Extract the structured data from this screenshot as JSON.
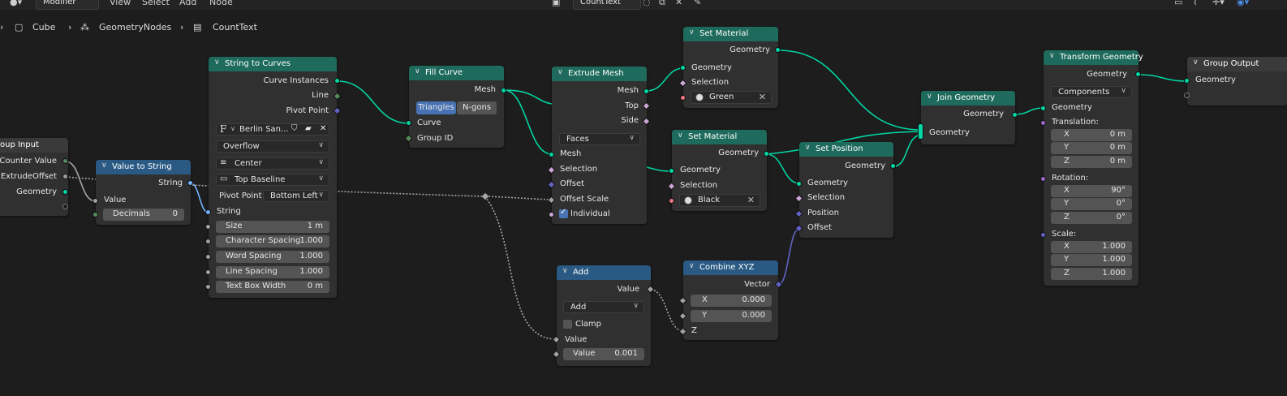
{
  "topbar": {
    "editor_type": "Modifier",
    "menus": [
      "View",
      "Select",
      "Add",
      "Node"
    ],
    "node_tree_name": "CountText"
  },
  "breadcrumb": [
    "Cube",
    "GeometryNodes",
    "CountText"
  ],
  "nodes": {
    "group_input": {
      "title": "oup Input",
      "outputs": [
        "Counter Value",
        "ExtrudeOffset",
        "Geometry"
      ]
    },
    "value_to_string": {
      "title": "Value to String",
      "output": "String",
      "input_value": "Value",
      "decimals_label": "Decimals",
      "decimals_value": "0"
    },
    "string_to_curves": {
      "title": "String to Curves",
      "outputs": [
        "Curve Instances",
        "Line",
        "Pivot Point"
      ],
      "font": "Berlin San...",
      "overflow": "Overflow",
      "align_x": "Center",
      "align_y": "Top Baseline",
      "pivot_label": "Pivot Point",
      "pivot_value": "Bottom Left",
      "input_string": "String",
      "fields": [
        {
          "label": "Size",
          "value": "1 m"
        },
        {
          "label": "Character Spacing",
          "value": "1.000"
        },
        {
          "label": "Word Spacing",
          "value": "1.000"
        },
        {
          "label": "Line Spacing",
          "value": "1.000"
        },
        {
          "label": "Text Box Width",
          "value": "0 m"
        }
      ]
    },
    "fill_curve": {
      "title": "Fill Curve",
      "output": "Mesh",
      "modes": [
        "Triangles",
        "N-gons"
      ],
      "inputs": [
        "Curve",
        "Group ID"
      ]
    },
    "extrude_mesh": {
      "title": "Extrude Mesh",
      "outputs": [
        "Mesh",
        "Top",
        "Side"
      ],
      "mode": "Faces",
      "inputs": [
        "Mesh",
        "Selection",
        "Offset",
        "Offset Scale"
      ],
      "individual": "Individual"
    },
    "set_material_1": {
      "title": "Set Material",
      "output": "Geometry",
      "inputs": [
        "Geometry",
        "Selection"
      ],
      "material": "Green"
    },
    "set_material_2": {
      "title": "Set Material",
      "output": "Geometry",
      "inputs": [
        "Geometry",
        "Selection"
      ],
      "material": "Black"
    },
    "set_position": {
      "title": "Set Position",
      "output": "Geometry",
      "inputs": [
        "Geometry",
        "Selection",
        "Position",
        "Offset"
      ]
    },
    "join_geometry": {
      "title": "Join Geometry",
      "output": "Geometry",
      "input": "Geometry"
    },
    "transform_geometry": {
      "title": "Transform Geometry",
      "output": "Geometry",
      "mode": "Components",
      "input": "Geometry",
      "translation_label": "Translation:",
      "translation": [
        {
          "axis": "X",
          "value": "0 m"
        },
        {
          "axis": "Y",
          "value": "0 m"
        },
        {
          "axis": "Z",
          "value": "0 m"
        }
      ],
      "rotation_label": "Rotation:",
      "rotation": [
        {
          "axis": "X",
          "value": "90°"
        },
        {
          "axis": "Y",
          "value": "0°"
        },
        {
          "axis": "Z",
          "value": "0°"
        }
      ],
      "scale_label": "Scale:",
      "scale": [
        {
          "axis": "X",
          "value": "1.000"
        },
        {
          "axis": "Y",
          "value": "1.000"
        },
        {
          "axis": "Z",
          "value": "1.000"
        }
      ]
    },
    "group_output": {
      "title": "Group Output",
      "input": "Geometry"
    },
    "add": {
      "title": "Add",
      "output": "Value",
      "operation": "Add",
      "clamp": "Clamp",
      "input_value": "Value",
      "field_label": "Value",
      "field_value": "0.001"
    },
    "combine_xyz": {
      "title": "Combine XYZ",
      "output": "Vector",
      "x_label": "X",
      "x_value": "0.000",
      "y_label": "Y",
      "y_value": "0.000",
      "z_label": "Z"
    }
  },
  "colors": {
    "geometry_header": "#1e6b5d",
    "converter_header": "#2a5a83",
    "geometry_socket": "#00d6a3",
    "wire": "#00d6a3",
    "background": "#1d1d1d"
  }
}
